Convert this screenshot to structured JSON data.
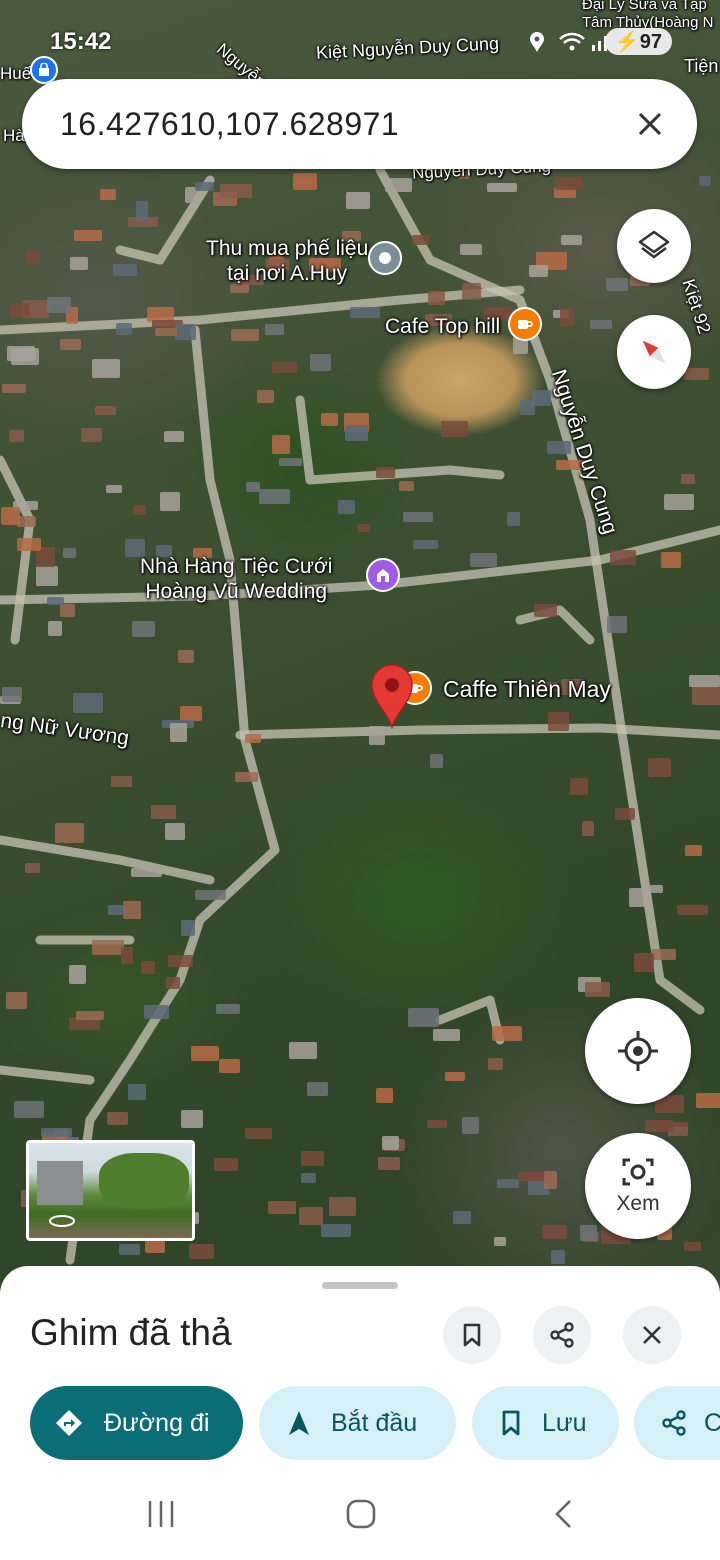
{
  "status_bar": {
    "time": "15:42",
    "battery": "97"
  },
  "search": {
    "query": "16.427610,107.628971"
  },
  "map": {
    "road_labels": [
      {
        "text": "Kiệt Nguyễn Duy Cung"
      },
      {
        "text": "Nguyễn Duy Cung"
      },
      {
        "text": "Kiệt 92"
      },
      {
        "text": "ng Nữ Vương"
      },
      {
        "text": "Nguyễn"
      },
      {
        "text": "Tiện"
      },
      {
        "text": "Huế"
      },
      {
        "text": "Hà"
      },
      {
        "text": "Nguyễn Duy Cung"
      }
    ],
    "corner_label": {
      "line1": "Đại Lý Sữa và Tạp",
      "line2": "Tâm Thủy(Hoàng N"
    },
    "pois": [
      {
        "line1": "Thu mua phế liệu",
        "line2": "tại nơi A.Huy",
        "icon": "pin-icon",
        "color": "#78909c"
      },
      {
        "line1": "Cafe Top hill",
        "line2": "",
        "icon": "cafe-icon",
        "color": "#f57c00"
      },
      {
        "line1": "Nhà Hàng Tiệc Cưới",
        "line2": "Hoàng Vũ Wedding",
        "icon": "event-venue-icon",
        "color": "#a05ce8"
      },
      {
        "line1": "Caffe Thiên May",
        "line2": "",
        "icon": "cafe-icon",
        "color": "#f57c00"
      }
    ],
    "dropped_pin_color": "#e53935"
  },
  "controls": {
    "view_label": "Xem"
  },
  "sheet": {
    "title": "Ghim đã thả",
    "chips": [
      {
        "label": "Đường đi",
        "icon": "directions-icon"
      },
      {
        "label": "Bắt đầu",
        "icon": "navigation-arrow-icon"
      },
      {
        "label": "Lưu",
        "icon": "bookmark-icon"
      },
      {
        "label": "C",
        "icon": "share-icon"
      }
    ]
  },
  "colors": {
    "accent": "#0b6e76",
    "chip_bg": "#d5f1f7",
    "chip_fg": "#0b5560"
  }
}
